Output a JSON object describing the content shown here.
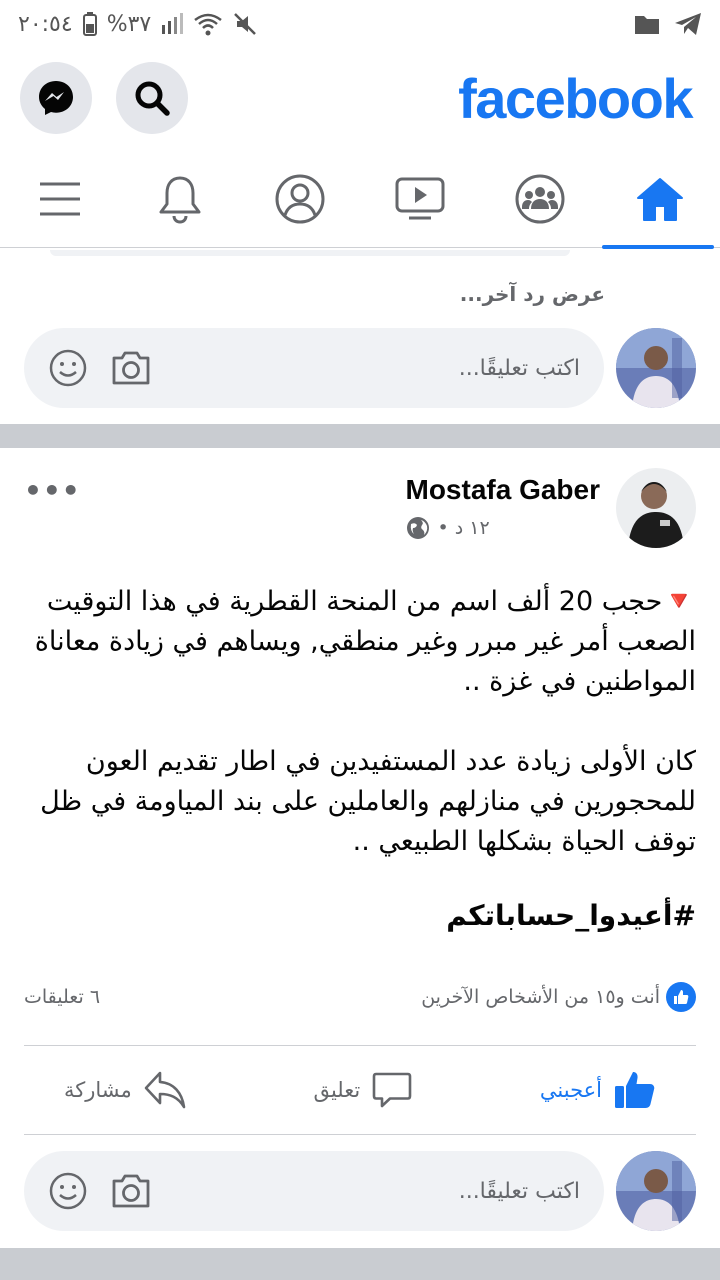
{
  "status_bar": {
    "time": "٢٠:٥٤",
    "battery": "%٣٧"
  },
  "header": {
    "brand": "facebook",
    "accent": "#1877f2"
  },
  "nav": {
    "tabs": [
      "menu",
      "notifications",
      "profile",
      "watch",
      "groups",
      "home"
    ],
    "active": "home"
  },
  "comments_top": {
    "more_replies": "عرض رد آخر...",
    "placeholder": "اكتب تعليقًا..."
  },
  "post": {
    "author": "Mostafa Gaber",
    "time": "١٢ د •",
    "paragraph1": "🔻حجب 20 ألف اسم من المنحة القطرية في هذا التوقيت الصعب أمر غير مبرر وغير منطقي, ويساهم في زيادة معاناة المواطنين في غزة ..",
    "paragraph2": "كان الأولى زيادة عدد المستفيدين في اطار تقديم العون للمحجورين في منازلهم والعاملين على بند المياومة في ظل توقف الحياة بشكلها الطبيعي ..",
    "hashtag": "#أعيدوا_حساباتكم",
    "likes_text": "أنت و١٥ من الأشخاص الآخرين",
    "comments_count": "٦ تعليقات",
    "actions": {
      "like": "أعجبني",
      "comment": "تعليق",
      "share": "مشاركة"
    },
    "comment_placeholder": "اكتب تعليقًا..."
  }
}
